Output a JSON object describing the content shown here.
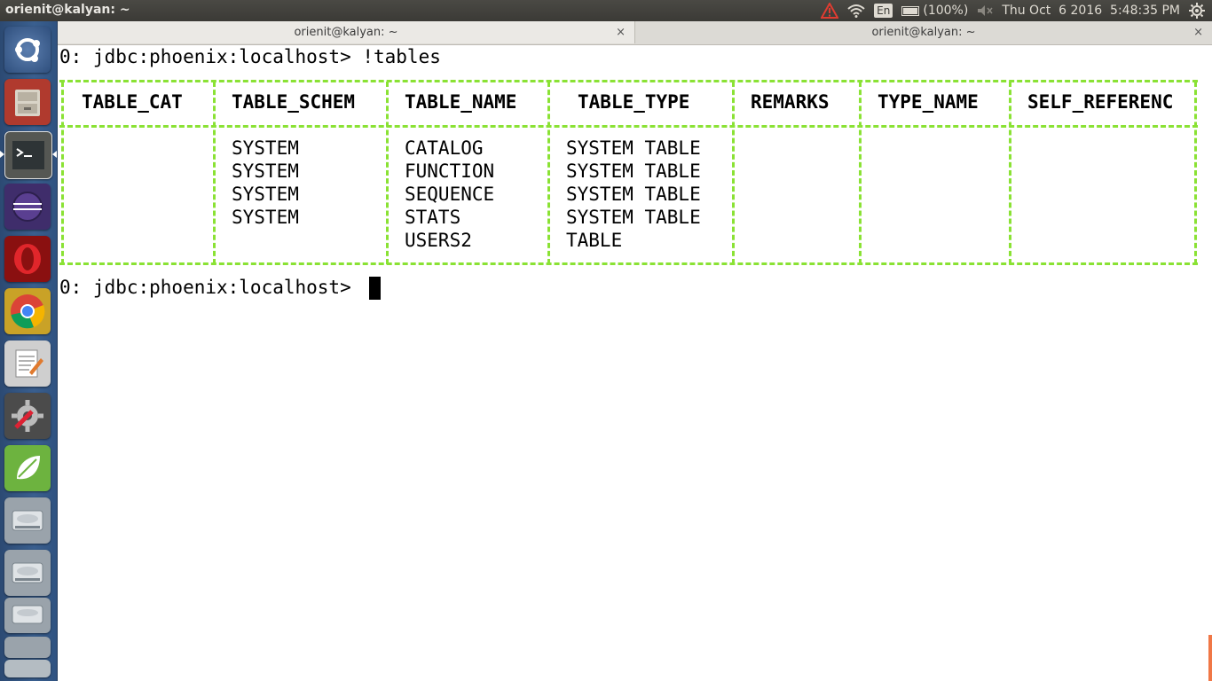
{
  "top_panel": {
    "title": "orienit@kalyan: ~",
    "battery": "(100%)",
    "language": "En",
    "datetime": "Thu Oct  6 2016  5:48:35 PM"
  },
  "terminal": {
    "tabs": [
      {
        "title": "orienit@kalyan: ~",
        "close": "×"
      },
      {
        "title": "orienit@kalyan: ~",
        "close": "×"
      }
    ],
    "command_line": "0: jdbc:phoenix:localhost> !tables",
    "prompt": "0: jdbc:phoenix:localhost> ",
    "table": {
      "headers": [
        "TABLE_CAT",
        "TABLE_SCHEM",
        "TABLE_NAME",
        "TABLE_TYPE",
        "REMARKS",
        "TYPE_NAME",
        "SELF_REFERENC"
      ],
      "rows": [
        [
          "",
          "SYSTEM",
          "CATALOG",
          "SYSTEM TABLE",
          "",
          "",
          ""
        ],
        [
          "",
          "SYSTEM",
          "FUNCTION",
          "SYSTEM TABLE",
          "",
          "",
          ""
        ],
        [
          "",
          "SYSTEM",
          "SEQUENCE",
          "SYSTEM TABLE",
          "",
          "",
          ""
        ],
        [
          "",
          "SYSTEM",
          "STATS",
          "SYSTEM TABLE",
          "",
          "",
          ""
        ],
        [
          "",
          "",
          "USERS2",
          "TABLE",
          "",
          "",
          ""
        ]
      ]
    }
  },
  "launcher": {
    "items": [
      "ubuntu-dash-icon",
      "file-manager-icon",
      "terminal-icon",
      "eclipse-icon",
      "opera-icon",
      "chrome-icon",
      "text-editor-icon",
      "system-settings-icon",
      "spring-tool-suite-icon",
      "disk-drive-icon",
      "disk-drive-icon",
      "disk-drive-icon"
    ]
  },
  "colors": {
    "border_green": "#8ae234",
    "panel": "#3c3b37",
    "launcher": "#3a5f8f"
  }
}
